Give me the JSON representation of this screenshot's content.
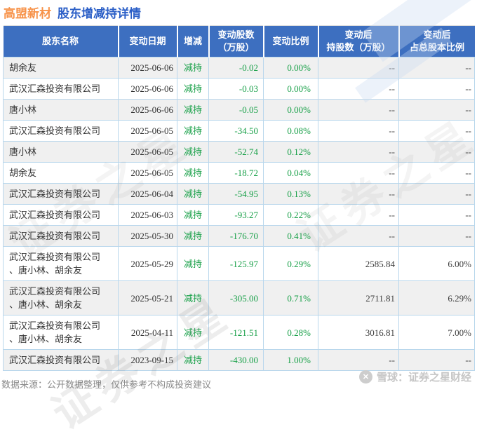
{
  "title": {
    "stock": "高盟新材",
    "subtitle": "股东增减持详情"
  },
  "colors": {
    "header_bg": "#3d6fc0",
    "decrease_green": "#18a048",
    "title_orange": "#f7934a",
    "title_blue": "#2b5fc7",
    "row_alt": "#f0f0f0",
    "grid_border": "#b9d7ec"
  },
  "table": {
    "headers": [
      {
        "lines": [
          "股东名称"
        ]
      },
      {
        "lines": [
          "变动日期"
        ]
      },
      {
        "lines": [
          "增减"
        ]
      },
      {
        "lines": [
          "变动股数",
          "（万股）"
        ]
      },
      {
        "lines": [
          "变动比例"
        ]
      },
      {
        "lines": [
          "变动后",
          "持股数（万股）"
        ]
      },
      {
        "lines": [
          "变动后",
          "占总股本比例"
        ]
      }
    ],
    "rows": [
      {
        "name": "胡余友",
        "date": "2025-06-06",
        "action": "减持",
        "shares_change": "-0.02",
        "ratio_change": "0.00%",
        "shares_after": "--",
        "ratio_after": "--"
      },
      {
        "name": "武汉汇森投资有限公司",
        "date": "2025-06-06",
        "action": "减持",
        "shares_change": "-0.03",
        "ratio_change": "0.00%",
        "shares_after": "--",
        "ratio_after": "--"
      },
      {
        "name": "唐小林",
        "date": "2025-06-06",
        "action": "减持",
        "shares_change": "-0.05",
        "ratio_change": "0.00%",
        "shares_after": "--",
        "ratio_after": "--"
      },
      {
        "name": "武汉汇森投资有限公司",
        "date": "2025-06-05",
        "action": "减持",
        "shares_change": "-34.50",
        "ratio_change": "0.08%",
        "shares_after": "--",
        "ratio_after": "--"
      },
      {
        "name": "唐小林",
        "date": "2025-06-05",
        "action": "减持",
        "shares_change": "-52.74",
        "ratio_change": "0.12%",
        "shares_after": "--",
        "ratio_after": "--"
      },
      {
        "name": "胡余友",
        "date": "2025-06-05",
        "action": "减持",
        "shares_change": "-18.72",
        "ratio_change": "0.04%",
        "shares_after": "--",
        "ratio_after": "--"
      },
      {
        "name": "武汉汇森投资有限公司",
        "date": "2025-06-04",
        "action": "减持",
        "shares_change": "-54.95",
        "ratio_change": "0.13%",
        "shares_after": "--",
        "ratio_after": "--"
      },
      {
        "name": "武汉汇森投资有限公司",
        "date": "2025-06-03",
        "action": "减持",
        "shares_change": "-93.27",
        "ratio_change": "0.22%",
        "shares_after": "--",
        "ratio_after": "--"
      },
      {
        "name": "武汉汇森投资有限公司",
        "date": "2025-05-30",
        "action": "减持",
        "shares_change": "-176.70",
        "ratio_change": "0.41%",
        "shares_after": "--",
        "ratio_after": "--"
      },
      {
        "name": "武汉汇森投资有限公司、唐小林、胡余友",
        "date": "2025-05-29",
        "action": "减持",
        "shares_change": "-125.97",
        "ratio_change": "0.29%",
        "shares_after": "2585.84",
        "ratio_after": "6.00%"
      },
      {
        "name": "武汉汇森投资有限公司、唐小林、胡余友",
        "date": "2025-05-21",
        "action": "减持",
        "shares_change": "-305.00",
        "ratio_change": "0.71%",
        "shares_after": "2711.81",
        "ratio_after": "6.29%"
      },
      {
        "name": "武汉汇森投资有限公司、唐小林、胡余友",
        "date": "2025-04-11",
        "action": "减持",
        "shares_change": "-121.51",
        "ratio_change": "0.28%",
        "shares_after": "3016.81",
        "ratio_after": "7.00%"
      },
      {
        "name": "武汉汇森投资有限公司",
        "date": "2023-09-15",
        "action": "减持",
        "shares_change": "-430.00",
        "ratio_change": "1.00%",
        "shares_after": "--",
        "ratio_after": "--"
      }
    ]
  },
  "footer": {
    "source_note": "数据来源：公开数据整理，仅供参考不构成投资建议",
    "brand": "雪球：证券之星财经"
  },
  "watermark": {
    "text": "证券之星"
  }
}
